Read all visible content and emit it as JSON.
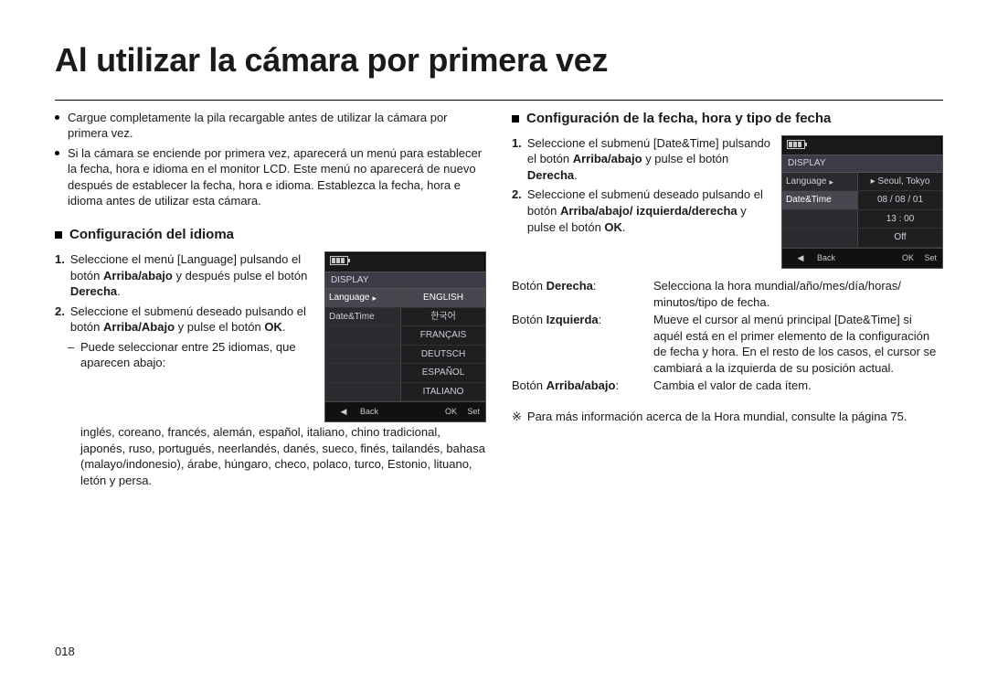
{
  "title": "Al utilizar la cámara por primera vez",
  "pagenum": "018",
  "left": {
    "bullets": [
      "Cargue completamente la pila recargable antes de utilizar la cámara por primera vez.",
      "Si la cámara se enciende por primera vez, aparecerá un menú para establecer la fecha, hora e idioma en el monitor LCD. Este menú no aparecerá de nuevo después de establecer la fecha, hora e idioma. Establezca la fecha, hora e idioma antes de utilizar esta cámara."
    ],
    "subheading": "Configuración del idioma",
    "step1_pre": "Seleccione el menú [Language] pulsando el botón ",
    "step1_bold1": "Arriba/abajo",
    "step1_mid": " y después pulse el botón ",
    "step1_bold2": "Derecha",
    "step1_end": ".",
    "step2_pre": "Seleccione el submenú deseado pulsando el botón ",
    "step2_bold1": "Arriba/Abajo",
    "step2_mid": " y pulse el botón ",
    "step2_bold2": "OK",
    "step2_end": ".",
    "note_dash": "–",
    "note": "Puede seleccionar entre 25 idiomas, que aparecen abajo:",
    "languages": "inglés, coreano, francés, alemán, español, italiano, chino tradicional, japonés, ruso, portugués, neerlandés, danés, sueco, finés, tailandés, bahasa (malayo/indonesio), árabe, húngaro, checo, polaco, turco, Estonio, lituano, letón y persa.",
    "lcd": {
      "section": "DISPLAY",
      "rows": [
        {
          "l": "Language",
          "r": "ENGLISH",
          "lsel": true,
          "rsel": true,
          "arrow": true
        },
        {
          "l": "Date&Time",
          "r": "한국어"
        },
        {
          "l": "",
          "r": "FRANÇAIS"
        },
        {
          "l": "",
          "r": "DEUTSCH"
        },
        {
          "l": "",
          "r": "ESPAÑOL"
        },
        {
          "l": "",
          "r": "ITALIANO"
        }
      ],
      "backArrow": "◀",
      "back": "Back",
      "ok": "OK",
      "okLabel": "Set"
    }
  },
  "right": {
    "subheading": "Configuración de la fecha, hora y tipo de fecha",
    "step1_pre": "Seleccione el submenú [Date&Time] pulsando el botón ",
    "step1_bold1": "Arriba/abajo",
    "step1_mid": " y pulse el botón ",
    "step1_bold2": "Derecha",
    "step1_end": ".",
    "step2_pre": "Seleccione el submenú deseado pulsando el botón ",
    "step2_bold1": "Arriba/abajo/ izquierda/derecha",
    "step2_mid": " y pulse el botón ",
    "step2_bold2": "OK",
    "step2_end": ".",
    "lcd": {
      "section": "DISPLAY",
      "rows": [
        {
          "l": "Language",
          "r": "▸ Seoul, Tokyo",
          "arrow": true
        },
        {
          "l": "Date&Time",
          "r": "08 / 08 / 01",
          "lsel": true
        },
        {
          "l": "",
          "r": "13 : 00"
        },
        {
          "l": "",
          "r": "Off"
        }
      ],
      "backArrow": "◀",
      "back": "Back",
      "ok": "OK",
      "okLabel": "Set"
    },
    "table": [
      {
        "label_pre": "Botón ",
        "label_bold": "Derecha",
        "label_post": ":",
        "desc": "Selecciona la hora mundial/año/mes/día/horas/ minutos/tipo de fecha."
      },
      {
        "label_pre": "Botón ",
        "label_bold": "Izquierda",
        "label_post": ":",
        "desc": "Mueve el cursor al menú principal [Date&Time] si aquél está en el primer elemento de la configuración de fecha y hora. En el resto de los casos, el cursor se cambiará a la izquierda de su posición actual."
      },
      {
        "label_pre": "Botón ",
        "label_bold": "Arriba/abajo",
        "label_post": ":",
        "desc": "Cambia el valor de cada ítem."
      }
    ],
    "footnote_mark": "※",
    "footnote": "Para más información acerca de la Hora mundial, consulte la página 75."
  },
  "labels": {
    "n1": "1.",
    "n2": "2."
  }
}
